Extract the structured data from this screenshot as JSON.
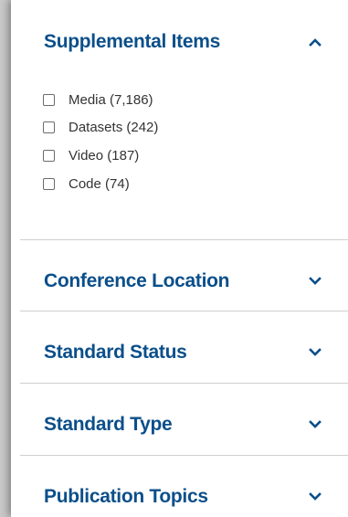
{
  "colors": {
    "heading": "#0b4f8a",
    "option_text": "#333333",
    "divider": "#cfcfcf",
    "chevron": "#0b4f8a"
  },
  "supplemental": {
    "title": "Supplemental Items",
    "expanded": true,
    "options": [
      {
        "label": "Media (7,186)",
        "checked": false
      },
      {
        "label": "Datasets (242)",
        "checked": false
      },
      {
        "label": "Video (187)",
        "checked": false
      },
      {
        "label": "Code (74)",
        "checked": false
      }
    ]
  },
  "sections": [
    {
      "title": "Conference Location",
      "expanded": false
    },
    {
      "title": "Standard Status",
      "expanded": false
    },
    {
      "title": "Standard Type",
      "expanded": false
    },
    {
      "title": "Publication Topics",
      "expanded": false
    }
  ]
}
